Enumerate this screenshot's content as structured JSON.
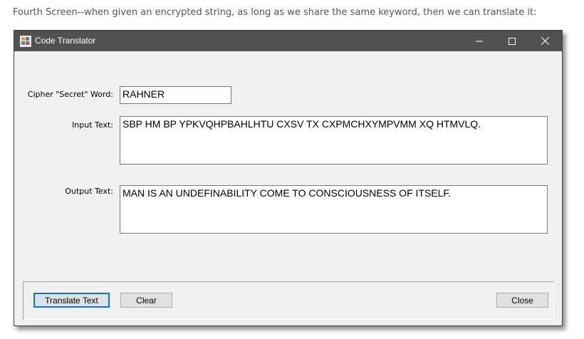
{
  "caption": "Fourth Screen--when given an encrypted string, as long as we share the same keyword, then we can translate it:",
  "window": {
    "title": "Code Translator",
    "controls": {
      "minimize": "–",
      "maximize": "☐",
      "close": "✕"
    }
  },
  "form": {
    "keyword_label": "Cipher \"Secret\" Word:",
    "keyword_value": "RAHNER",
    "input_label": "Input Text:",
    "input_value": "SBP HM BP YPKVQHPBAHLHTU CXSV TX CXPMCHXYMPVMM XQ HTMVLQ.",
    "output_label": "Output Text:",
    "output_value": "MAN IS AN UNDEFINABILITY COME TO CONSCIOUSNESS OF ITSELF."
  },
  "buttons": {
    "translate": "Translate Text",
    "clear": "Clear",
    "close": "Close"
  },
  "colors": {
    "titlebar": "#515151",
    "window_bg": "#f0f0f0",
    "default_button_border": "#0078d7"
  }
}
